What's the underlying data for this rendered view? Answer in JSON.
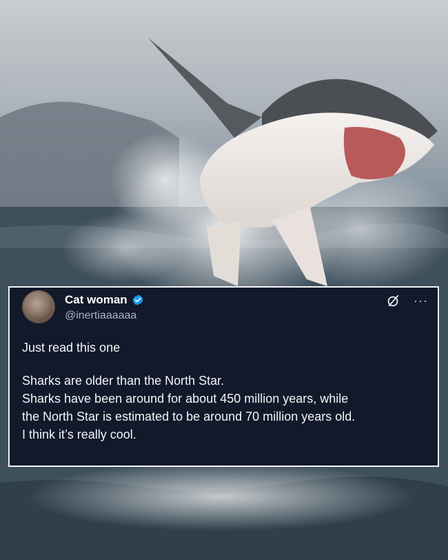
{
  "tweet": {
    "display_name": "Cat woman",
    "handle": "@inertiaaaaaa",
    "intro": "Just read this one",
    "lines": [
      "Sharks are older than the North Star.",
      "Sharks have been around for about 450 million years, while",
      "the North Star is estimated to be around 70 million years old.",
      "I think it’s really cool."
    ],
    "more_label": "···"
  },
  "icons": {
    "avatar": "avatar-image",
    "verified": "verified-badge-icon",
    "share": "grok-icon",
    "more": "more-options-icon"
  },
  "colors": {
    "card_bg": "#11192a",
    "card_border": "#f2f4f6",
    "verified_blue": "#1d9bf0",
    "handle_gray": "#aab4c0"
  }
}
